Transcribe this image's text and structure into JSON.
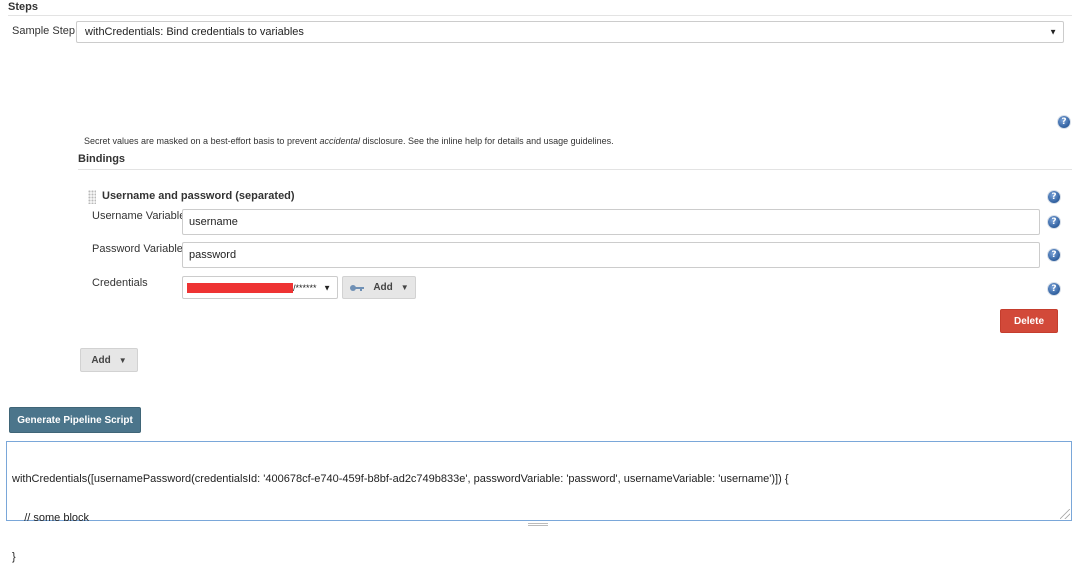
{
  "steps": {
    "title": "Steps",
    "sample_step_label": "Sample Step",
    "sample_step_value": "withCredentials: Bind credentials to variables"
  },
  "notice": {
    "prefix": "Secret values are masked on a best-effort basis to prevent ",
    "emphasis": "accidental",
    "suffix": " disclosure. See the inline help for details and usage guidelines."
  },
  "bindings": {
    "title": "Bindings",
    "item": {
      "title": "Username and password (separated)",
      "username_label": "Username Variable",
      "username_value": "username",
      "password_label": "Password Variable",
      "password_value": "password",
      "credentials_label": "Credentials",
      "credentials_value_masked": "/******",
      "add_label": "Add",
      "delete_label": "Delete"
    },
    "add_label": "Add"
  },
  "generate_label": "Generate Pipeline Script",
  "script": {
    "line1": "withCredentials([usernamePassword(credentialsId: '400678cf-e740-459f-b8bf-ad2c749b833e', passwordVariable: 'password', usernameVariable: 'username')]) {",
    "line2": "    // some block",
    "line3": "}"
  },
  "icons": {
    "help": "?",
    "caret": "▼",
    "key": "key-icon"
  },
  "colors": {
    "delete_red": "#d24939",
    "generate_blue": "#4b758b",
    "redaction": "#ee3333",
    "help_blue": "#2f5f9e"
  }
}
